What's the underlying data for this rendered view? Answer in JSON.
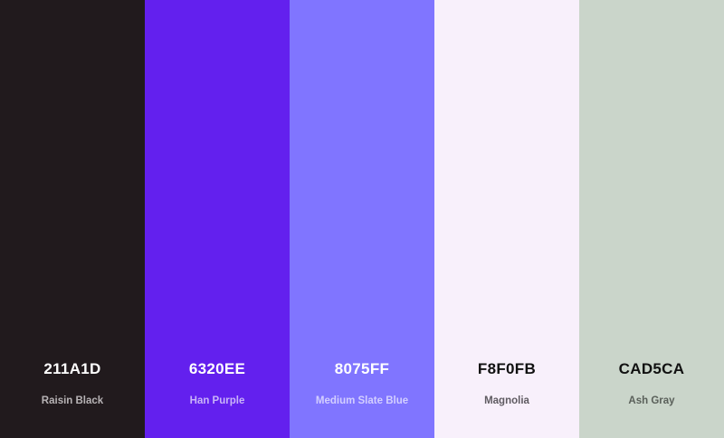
{
  "palette": {
    "swatches": [
      {
        "hex": "211A1D",
        "name": "Raisin Black",
        "color": "#211A1D",
        "hex_text_color": "#FFFFFF",
        "name_text_color": "#B7B3B5"
      },
      {
        "hex": "6320EE",
        "name": "Han Purple",
        "color": "#6320EE",
        "hex_text_color": "#FFFFFF",
        "name_text_color": "#C9B4F8"
      },
      {
        "hex": "8075FF",
        "name": "Medium Slate Blue",
        "color": "#8075FF",
        "hex_text_color": "#FFFFFF",
        "name_text_color": "#D3CFFF"
      },
      {
        "hex": "F8F0FB",
        "name": "Magnolia",
        "color": "#F8F0FB",
        "hex_text_color": "#111111",
        "name_text_color": "#5F5B61"
      },
      {
        "hex": "CAD5CA",
        "name": "Ash Gray",
        "color": "#CAD5CA",
        "hex_text_color": "#111111",
        "name_text_color": "#5A605A"
      }
    ]
  }
}
